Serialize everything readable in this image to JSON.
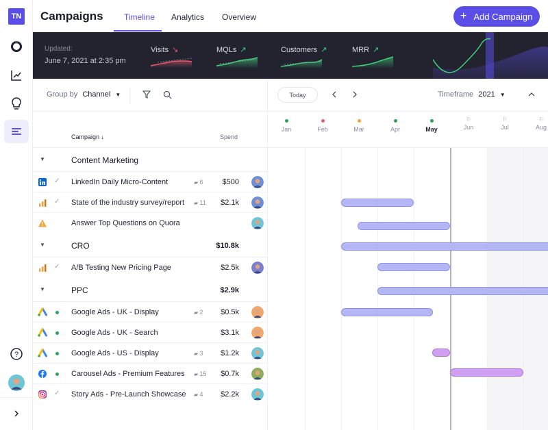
{
  "rail": {
    "logo": "TN"
  },
  "header": {
    "title": "Campaigns",
    "tabs": [
      "Timeline",
      "Analytics",
      "Overview"
    ],
    "add_button": "Add Campaign"
  },
  "metrics": {
    "updated_label": "Updated:",
    "updated_value": "June 7, 2021 at 2:35 pm",
    "items": [
      {
        "label": "Visits",
        "trend": "down",
        "arrow": "↘"
      },
      {
        "label": "MQLs",
        "trend": "up",
        "arrow": "↗"
      },
      {
        "label": "Customers",
        "trend": "up",
        "arrow": "↗"
      },
      {
        "label": "MRR",
        "trend": "up",
        "arrow": "↗"
      }
    ]
  },
  "toolbar": {
    "group_by_label": "Group by",
    "group_by_value": "Channel",
    "today": "Today",
    "timeframe_label": "Timeframe",
    "timeframe_value": "2021"
  },
  "columns": {
    "campaign": "Campaign ↓",
    "spend": "Spend"
  },
  "months": [
    {
      "label": "Jan",
      "marker": "dot",
      "color": "#2fa35b"
    },
    {
      "label": "Feb",
      "marker": "dot",
      "color": "#ef5a6f"
    },
    {
      "label": "Mar",
      "marker": "dot",
      "color": "#f5a23a"
    },
    {
      "label": "Apr",
      "marker": "dot",
      "color": "#2fa35b"
    },
    {
      "label": "May",
      "marker": "dot",
      "color": "#2fa35b",
      "current": true
    },
    {
      "label": "Jun",
      "marker": "flag"
    },
    {
      "label": "Jul",
      "marker": "flag"
    },
    {
      "label": "Aug",
      "marker": "flag"
    }
  ],
  "groups": [
    {
      "name": "Content Marketing",
      "spend": "",
      "rows": [
        {
          "icon": "linkedin-icon",
          "status": "check",
          "name": "LinkedIn Daily Micro-Content",
          "comments": "6",
          "spend": "$500",
          "avatar": "#6c8fd6"
        },
        {
          "icon": "analytics-icon",
          "status": "check",
          "name": "State of the industry survey/report",
          "comments": "11",
          "spend": "$2.1k",
          "avatar": "#6c8fd6"
        },
        {
          "icon": "warning-icon",
          "status": "",
          "name": "Answer Top Questions on Quora",
          "comments": "",
          "spend": "",
          "avatar": "#6cc6d8"
        }
      ]
    },
    {
      "name": "CRO",
      "spend": "$10.8k",
      "rows": [
        {
          "icon": "analytics-icon",
          "status": "check",
          "name": "A/B Testing New Pricing Page",
          "comments": "",
          "spend": "$2.5k",
          "avatar": "#7b7fd0"
        }
      ]
    },
    {
      "name": "PPC",
      "spend": "$2.9k",
      "rows": [
        {
          "icon": "google-ads-icon",
          "status": "dot",
          "name": "Google Ads - UK - Display",
          "comments": "2",
          "spend": "$0.5k",
          "avatar": "#f0a86a"
        },
        {
          "icon": "google-ads-icon",
          "status": "dot",
          "name": "Google Ads - UK - Search",
          "comments": "",
          "spend": "$3.1k",
          "avatar": "#f0a86a"
        },
        {
          "icon": "google-ads-icon",
          "status": "dot",
          "name": "Google Ads - US - Display",
          "comments": "3",
          "spend": "$1.2k",
          "avatar": "#6cc6d8"
        },
        {
          "icon": "facebook-icon",
          "status": "dot",
          "name": "Carousel Ads - Premium Features",
          "comments": "15",
          "spend": "$0.7k",
          "avatar": "#8fae5a"
        },
        {
          "icon": "instagram-icon",
          "status": "check",
          "name": "Story Ads - Pre-Launch Showcase",
          "comments": "4",
          "spend": "$2.2k",
          "avatar": "#6cc6d8"
        }
      ]
    }
  ]
}
